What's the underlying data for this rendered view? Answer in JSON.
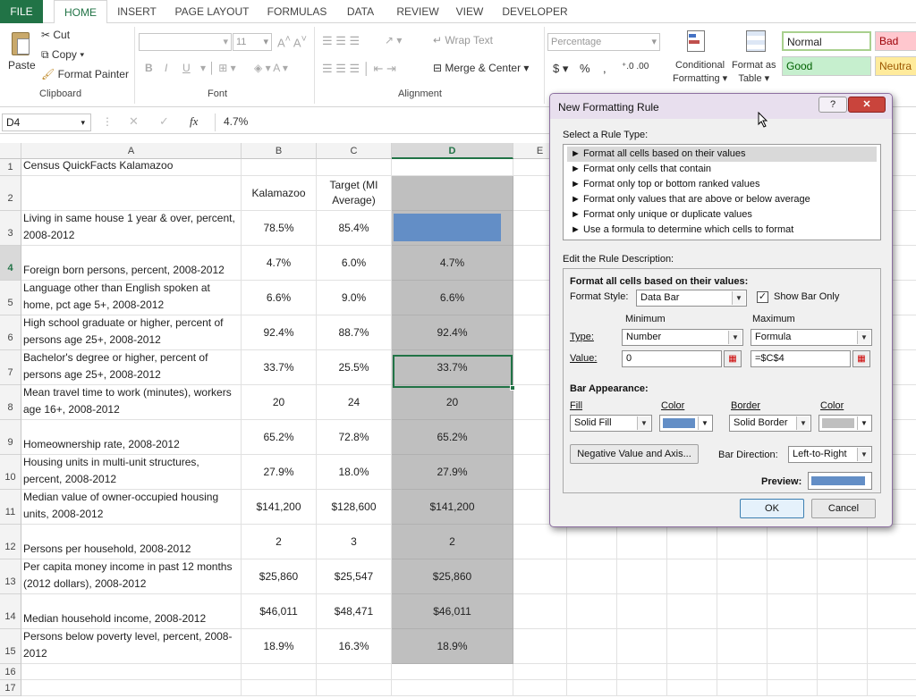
{
  "ribbon": {
    "tabs": [
      "FILE",
      "HOME",
      "INSERT",
      "PAGE LAYOUT",
      "FORMULAS",
      "DATA",
      "REVIEW",
      "VIEW",
      "DEVELOPER"
    ],
    "clipboard": {
      "paste": "Paste",
      "cut": "Cut",
      "copy": "Copy",
      "format_painter": "Format Painter",
      "group": "Clipboard"
    },
    "font": {
      "size": "11",
      "bold": "B",
      "italic": "I",
      "underline": "U",
      "group": "Font"
    },
    "alignment": {
      "wrap": "Wrap Text",
      "merge": "Merge & Center",
      "group": "Alignment"
    },
    "number": {
      "format": "Percentage",
      "currency": "$",
      "percent": "%",
      "comma": ","
    },
    "styles": {
      "conditional": [
        "Conditional",
        "Formatting"
      ],
      "table": [
        "Format as",
        "Table"
      ],
      "normal": "Normal",
      "bad": "Bad",
      "good": "Good",
      "neutral": "Neutra"
    }
  },
  "formula_bar": {
    "name_box": "D4",
    "fx": "fx",
    "value": "4.7%"
  },
  "grid": {
    "columns": [
      "A",
      "B",
      "C",
      "D",
      "E"
    ],
    "rows": [
      {
        "n": "1",
        "a": "Census QuickFacts Kalamazoo",
        "b": "",
        "c": "",
        "d": ""
      },
      {
        "n": "2",
        "a": "",
        "b": "Kalamazoo",
        "c": "Target (MI Average)",
        "d": ""
      },
      {
        "n": "3",
        "a": "Living in same house 1 year & over, percent, 2008-2012",
        "b": "78.5%",
        "c": "85.4%",
        "d": ""
      },
      {
        "n": "4",
        "a": "Foreign born persons, percent, 2008-2012",
        "b": "4.7%",
        "c": "6.0%",
        "d": "4.7%"
      },
      {
        "n": "5",
        "a": "Language other than English spoken at home, pct age 5+, 2008-2012",
        "b": "6.6%",
        "c": "9.0%",
        "d": "6.6%"
      },
      {
        "n": "6",
        "a": "High school graduate or higher, percent of persons age 25+, 2008-2012",
        "b": "92.4%",
        "c": "88.7%",
        "d": "92.4%"
      },
      {
        "n": "7",
        "a": "Bachelor's degree or higher, percent of persons age 25+, 2008-2012",
        "b": "33.7%",
        "c": "25.5%",
        "d": "33.7%"
      },
      {
        "n": "8",
        "a": "Mean travel time to work (minutes), workers age 16+, 2008-2012",
        "b": "20",
        "c": "24",
        "d": "20"
      },
      {
        "n": "9",
        "a": "Homeownership rate, 2008-2012",
        "b": "65.2%",
        "c": "72.8%",
        "d": "65.2%"
      },
      {
        "n": "10",
        "a": "Housing units in multi-unit structures, percent, 2008-2012",
        "b": "27.9%",
        "c": "18.0%",
        "d": "27.9%"
      },
      {
        "n": "11",
        "a": "Median value of owner-occupied housing units, 2008-2012",
        "b": "$141,200",
        "c": "$128,600",
        "d": "$141,200"
      },
      {
        "n": "12",
        "a": "Persons per household, 2008-2012",
        "b": "2",
        "c": "3",
        "d": "2"
      },
      {
        "n": "13",
        "a": "Per capita money income in past 12 months (2012 dollars), 2008-2012",
        "b": "$25,860",
        "c": "$25,547",
        "d": "$25,860"
      },
      {
        "n": "14",
        "a": "Median household income, 2008-2012",
        "b": "$46,011",
        "c": "$48,471",
        "d": "$46,011"
      },
      {
        "n": "15",
        "a": "Persons below poverty level, percent, 2008-2012",
        "b": "18.9%",
        "c": "16.3%",
        "d": "18.9%"
      },
      {
        "n": "16",
        "a": "",
        "b": "",
        "c": "",
        "d": ""
      },
      {
        "n": "17",
        "a": "",
        "b": "",
        "c": "",
        "d": ""
      }
    ]
  },
  "dialog": {
    "title": "New Formatting Rule",
    "help": "?",
    "close": "✕",
    "select_type_label": "Select a Rule Type:",
    "rule_types": [
      "Format all cells based on their values",
      "Format only cells that contain",
      "Format only top or bottom ranked values",
      "Format only values that are above or below average",
      "Format only unique or duplicate values",
      "Use a formula to determine which cells to format"
    ],
    "edit_label": "Edit the Rule Description:",
    "desc_heading": "Format all cells based on their values:",
    "format_style_label": "Format Style:",
    "format_style": "Data Bar",
    "show_bar_only": "Show Bar Only",
    "minimum": "Minimum",
    "maximum": "Maximum",
    "type_label": "Type:",
    "min_type": "Number",
    "max_type": "Formula",
    "value_label": "Value:",
    "min_value": "0",
    "max_value": "=$C$4",
    "bar_appearance": "Bar Appearance:",
    "fill_label": "Fill",
    "fill": "Solid Fill",
    "color_label": "Color",
    "border_label": "Border",
    "border": "Solid Border",
    "color2_label": "Color",
    "neg_button": "Negative Value and Axis...",
    "direction_label": "Bar Direction:",
    "direction": "Left-to-Right",
    "preview_label": "Preview:",
    "ok": "OK",
    "cancel": "Cancel",
    "colors": {
      "bar": "#638ec6",
      "border": "#bfbfbf"
    }
  }
}
